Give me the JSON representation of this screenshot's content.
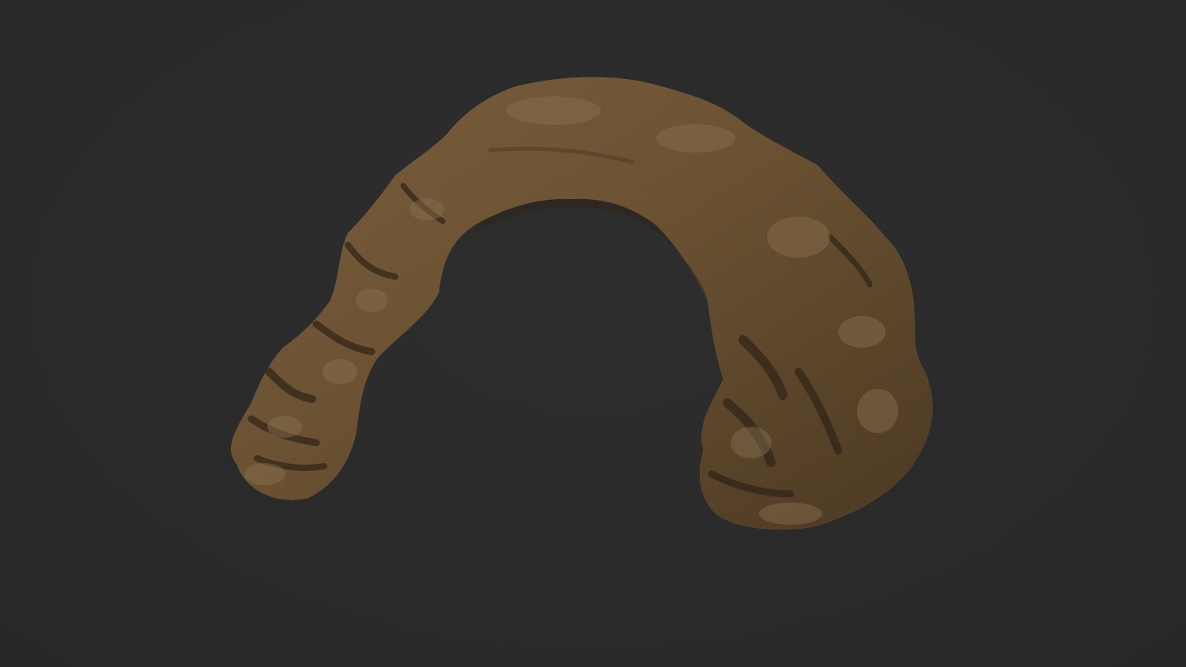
{
  "scene": {
    "subject": "rock-arch",
    "colors": {
      "background": "#2b2b2b",
      "rock_base": "#6e5639",
      "rock_light": "#8f7550",
      "rock_dark": "#3e3020",
      "rock_highlight": "#a08a6a"
    }
  }
}
